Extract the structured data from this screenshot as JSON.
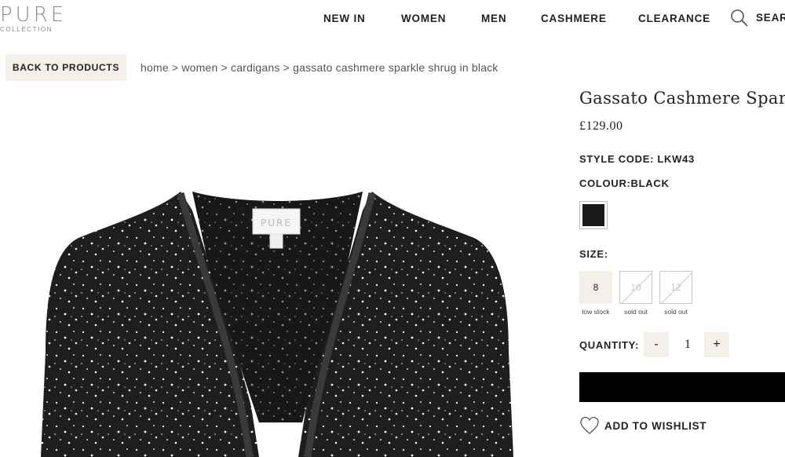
{
  "brand": {
    "name": "PURE",
    "sub": "COLLECTION"
  },
  "nav": {
    "items": [
      "NEW IN",
      "WOMEN",
      "MEN",
      "CASHMERE",
      "CLEARANCE"
    ],
    "search_label": "SEAR"
  },
  "breadcrumb": {
    "back_label": "BACK TO PRODUCTS",
    "trail": "home > women > cardigans > gassato cashmere sparkle shrug in black"
  },
  "product": {
    "title": "Gassato Cashmere Spark",
    "price": "£129.00",
    "style_code": "STYLE CODE: LKW43",
    "colour_label": "COLOUR:BLACK",
    "swatch_color": "#1a1a1a",
    "tag_text": "PURE",
    "size_label": "SIZE:",
    "sizes": [
      {
        "value": "8",
        "note": "low stock",
        "state": "available"
      },
      {
        "value": "10",
        "note": "sold out",
        "state": "sold-out"
      },
      {
        "value": "12",
        "note": "sold out",
        "state": "sold-out"
      }
    ],
    "quantity_label": "QUANTITY:",
    "quantity_minus": "-",
    "quantity_plus": "+",
    "quantity_value": "1",
    "wishlist_label": "ADD TO WISHLIST"
  },
  "colors": {
    "accent_bg": "#f4efe9",
    "text": "#222222",
    "cta": "#000000"
  }
}
